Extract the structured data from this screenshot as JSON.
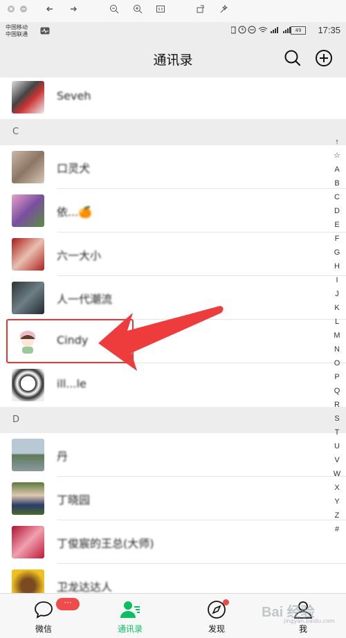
{
  "toolbar": {
    "icons": [
      "close-icon",
      "minimize-icon",
      "back-icon",
      "forward-icon",
      "zoom-out-icon",
      "zoom-in-icon",
      "fit-icon",
      "rotate-icon",
      "magic-icon"
    ]
  },
  "status_bar": {
    "carrier_1": "中国移动",
    "carrier_2": "中国联通",
    "battery": "49",
    "time": "17:35"
  },
  "header": {
    "title": "通讯录"
  },
  "contacts": {
    "top_row": {
      "name": "Seveh"
    },
    "section_c": "C",
    "section_d": "D",
    "rows": [
      {
        "name": "口灵犬"
      },
      {
        "name": "依...🍊"
      },
      {
        "name": "六一大小"
      },
      {
        "name": "人一代潮流"
      },
      {
        "name": "Cindy"
      },
      {
        "name": "ill...le"
      },
      {
        "name": "丹"
      },
      {
        "name": "丁晓园"
      },
      {
        "name": "丁俊宸的王总(大师)"
      },
      {
        "name": "卫龙达达人"
      }
    ]
  },
  "index_bar": [
    "↑",
    "☆",
    "A",
    "B",
    "C",
    "D",
    "E",
    "F",
    "G",
    "H",
    "I",
    "J",
    "K",
    "L",
    "M",
    "N",
    "O",
    "P",
    "Q",
    "R",
    "S",
    "T",
    "U",
    "V",
    "W",
    "X",
    "Y",
    "Z",
    "#"
  ],
  "tabbar": {
    "tabs": [
      {
        "label": "微信",
        "badge": "···"
      },
      {
        "label": "通讯录"
      },
      {
        "label": "发现"
      },
      {
        "label": "我"
      }
    ],
    "active_color": "#07c160"
  },
  "watermark": {
    "text": "Bai 经验",
    "sub": "jingyan.baidu.com"
  }
}
